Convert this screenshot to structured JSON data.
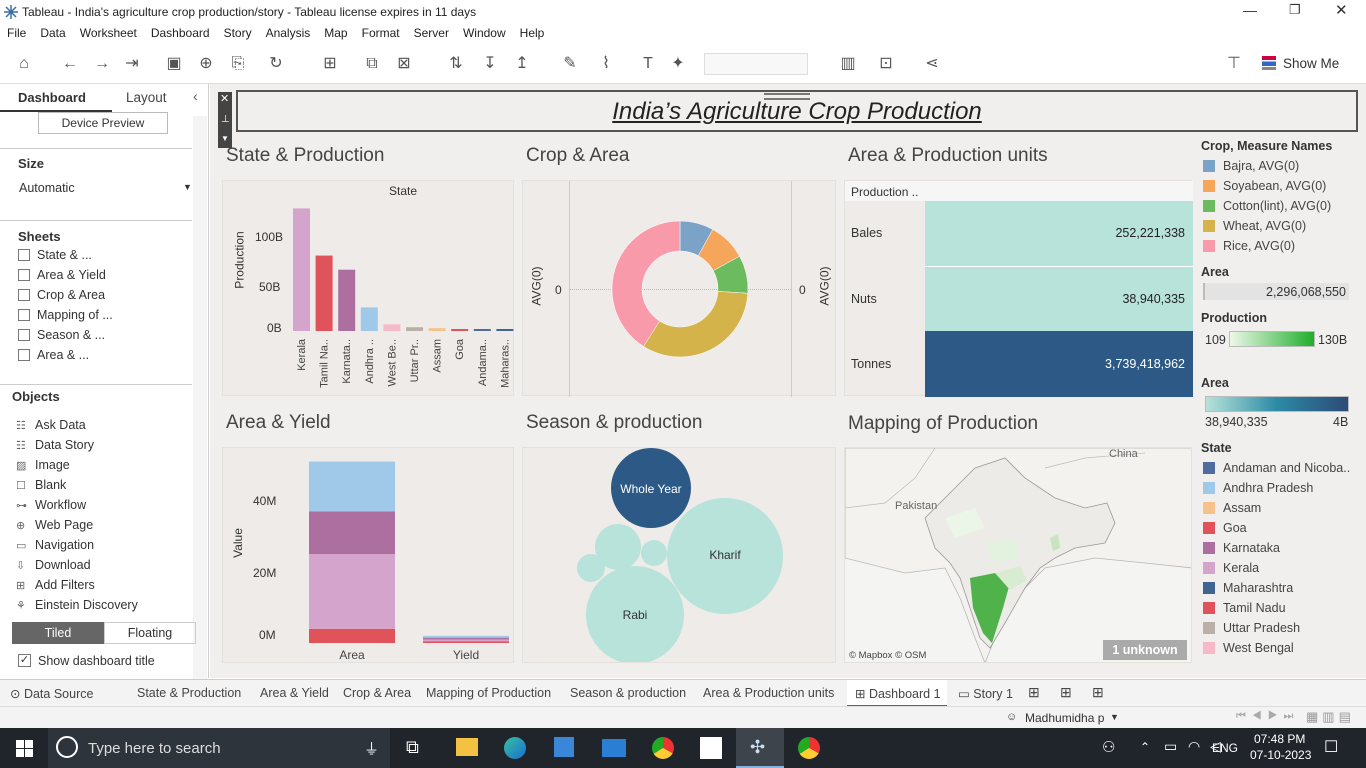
{
  "window": {
    "title": "Tableau - India's agriculture crop production/story - Tableau license expires in 11 days"
  },
  "menu": [
    "File",
    "Data",
    "Worksheet",
    "Dashboard",
    "Story",
    "Analysis",
    "Map",
    "Format",
    "Server",
    "Window",
    "Help"
  ],
  "toolbar": {
    "show_me": "Show Me"
  },
  "left": {
    "tab_dashboard": "Dashboard",
    "tab_layout": "Layout",
    "device_preview": "Device Preview",
    "size_header": "Size",
    "size_value": "Automatic",
    "sheets_header": "Sheets",
    "sheets": [
      "State & ...",
      "Area & Yield",
      "Crop & Area",
      "Mapping of ...",
      "Season & ...",
      "Area & ..."
    ],
    "objects_header": "Objects",
    "objects": [
      {
        "label": "Ask Data",
        "icon": "ask-data-icon"
      },
      {
        "label": "Data Story",
        "icon": "data-story-icon"
      },
      {
        "label": "Image",
        "icon": "image-icon"
      },
      {
        "label": "Blank",
        "icon": "blank-icon"
      },
      {
        "label": "Workflow",
        "icon": "workflow-icon"
      },
      {
        "label": "Web Page",
        "icon": "web-page-icon"
      },
      {
        "label": "Navigation",
        "icon": "navigation-icon"
      },
      {
        "label": "Download",
        "icon": "download-icon"
      },
      {
        "label": "Add Filters",
        "icon": "add-filters-icon"
      },
      {
        "label": "Einstein Discovery",
        "icon": "einstein-discovery-icon"
      }
    ],
    "tiled": "Tiled",
    "floating": "Floating",
    "show_title": "Show dashboard title"
  },
  "dashboard": {
    "title": "India’s Agriculture Crop Production",
    "p1": {
      "title": "State & Production",
      "header": "State",
      "ylabel": "Production",
      "ticks": [
        "100B",
        "50B",
        "0B"
      ]
    },
    "p2": {
      "title": "Crop & Area",
      "ylabel": "AVG(0)",
      "zero": "0"
    },
    "p3": {
      "title": "Area & Production units",
      "header": "Production ..",
      "rows": [
        {
          "label": "Bales",
          "value": "252,221,338"
        },
        {
          "label": "Nuts",
          "value": "38,940,335"
        },
        {
          "label": "Tonnes",
          "value": "3,739,418,962"
        }
      ]
    },
    "p4": {
      "title": "Area & Yield",
      "ylabel": "Value",
      "ticks": [
        "40M",
        "20M",
        "0M"
      ],
      "cats": [
        "Area",
        "Yield"
      ]
    },
    "p5": {
      "title": "Season & production",
      "labels": {
        "whole": "Whole Year",
        "kharif": "Kharif",
        "rabi": "Rabi"
      }
    },
    "p6": {
      "title": "Mapping of Production",
      "china": "China",
      "pakistan": "Pakistan",
      "credit": "© Mapbox © OSM",
      "unknown": "1 unknown"
    }
  },
  "legends": {
    "crop_header": "Crop, Measure Names",
    "crops": [
      {
        "name": "Bajra, AVG(0)",
        "color": "#7ba3c8"
      },
      {
        "name": "Soyabean, AVG(0)",
        "color": "#f5a65b"
      },
      {
        "name": "Cotton(lint), AVG(0)",
        "color": "#6dbb5f"
      },
      {
        "name": "Wheat, AVG(0)",
        "color": "#d4b44a"
      },
      {
        "name": "Rice, AVG(0)",
        "color": "#f89aaa"
      }
    ],
    "area_header": "Area",
    "area_value": "2,296,068,550",
    "prod_header": "Production",
    "prod_min": "109",
    "prod_max": "130B",
    "area2_header": "Area",
    "area2_min": "38,940,335",
    "area2_max": "4B",
    "state_header": "State",
    "states": [
      {
        "name": "Andaman and Nicoba..",
        "color": "#4e6c9c"
      },
      {
        "name": "Andhra Pradesh",
        "color": "#a0c8e8"
      },
      {
        "name": "Assam",
        "color": "#f6c18a"
      },
      {
        "name": "Goa",
        "color": "#e0535a"
      },
      {
        "name": "Karnataka",
        "color": "#ad6f9f"
      },
      {
        "name": "Kerala",
        "color": "#d4a4cc"
      },
      {
        "name": "Maharashtra",
        "color": "#3f6592"
      },
      {
        "name": "Tamil Nadu",
        "color": "#e0535a"
      },
      {
        "name": "Uttar Pradesh",
        "color": "#bab0a8"
      },
      {
        "name": "West Bengal",
        "color": "#f7b8c8"
      }
    ]
  },
  "chart_data": [
    {
      "type": "bar",
      "title": "State & Production",
      "xlabel": "State",
      "ylabel": "Production",
      "categories": [
        "Kerala",
        "Tamil Na..",
        "Karnata..",
        "Andhra ..",
        "West Be..",
        "Uttar Pr..",
        "Assam",
        "Goa",
        "Andama..",
        "Maharas.."
      ],
      "values": [
        130,
        80,
        65,
        25,
        7,
        4,
        3,
        2,
        1,
        1
      ],
      "units": "B",
      "ylim": [
        0,
        140
      ]
    },
    {
      "type": "pie",
      "title": "Crop & Area",
      "labels": [
        "Bajra",
        "Soyabean",
        "Cotton(lint)",
        "Wheat",
        "Rice"
      ],
      "values": [
        8,
        9,
        9,
        33,
        41
      ]
    },
    {
      "type": "bar",
      "title": "Area & Yield",
      "categories": [
        "Area",
        "Yield"
      ],
      "ylabel": "Value",
      "series": [
        {
          "name": "Tamil Nadu",
          "values": [
            4,
            0.5
          ]
        },
        {
          "name": "Kerala",
          "values": [
            21,
            0.5
          ]
        },
        {
          "name": "Karnataka",
          "values": [
            12,
            0.5
          ]
        },
        {
          "name": "Andhra Pradesh",
          "values": [
            14,
            0.5
          ]
        }
      ],
      "ylim": [
        0,
        52
      ]
    }
  ],
  "tabs": {
    "data_source": "Data Source",
    "sheets": [
      "State & Production",
      "Area & Yield",
      "Crop & Area",
      "Mapping of Production",
      "Season & production",
      "Area & Production units"
    ],
    "dashboard": "Dashboard 1",
    "story": "Story 1"
  },
  "status": {
    "user": "Madhumidha p"
  },
  "taskbar": {
    "search": "Type here to search",
    "lang": "ENG",
    "time": "07:48 PM",
    "date": "07-10-2023"
  }
}
